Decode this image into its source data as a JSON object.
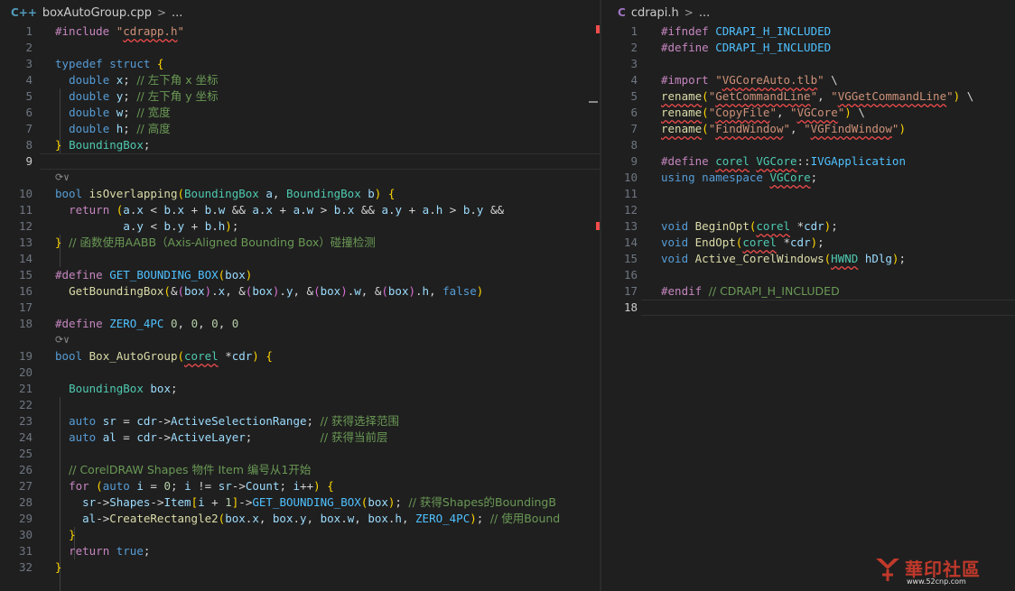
{
  "left_editor": {
    "file_name": "boxAutoGroup.cpp",
    "file_icon": "C++",
    "breadcrumb_sep": ">",
    "breadcrumb_more": "...",
    "lens_icon": "⟳∨",
    "lines": [
      {
        "n": "1",
        "t": "#include \"cdrapp.h\""
      },
      {
        "n": "2",
        "t": ""
      },
      {
        "n": "3",
        "t": "typedef struct {"
      },
      {
        "n": "4",
        "t": "  double x; // 左下角 x 坐标"
      },
      {
        "n": "5",
        "t": "  double y; // 左下角 y 坐标"
      },
      {
        "n": "6",
        "t": "  double w; // 宽度"
      },
      {
        "n": "7",
        "t": "  double h; // 高度"
      },
      {
        "n": "8",
        "t": "} BoundingBox;"
      },
      {
        "n": "9",
        "t": ""
      },
      {
        "n": "10",
        "t": "bool isOverlapping(BoundingBox a, BoundingBox b) {"
      },
      {
        "n": "11",
        "t": "  return (a.x < b.x + b.w && a.x + a.w > b.x && a.y + a.h > b.y &&"
      },
      {
        "n": "12",
        "t": "          a.y < b.y + b.h);"
      },
      {
        "n": "13",
        "t": "} // 函数使用AABB（Axis-Aligned Bounding Box）碰撞检测"
      },
      {
        "n": "14",
        "t": ""
      },
      {
        "n": "15",
        "t": "#define GET_BOUNDING_BOX(box)"
      },
      {
        "n": "16",
        "t": "  GetBoundingBox(&(box).x, &(box).y, &(box).w, &(box).h, false)"
      },
      {
        "n": "17",
        "t": ""
      },
      {
        "n": "18",
        "t": "#define ZERO_4PC 0, 0, 0, 0"
      },
      {
        "n": "19",
        "t": "bool Box_AutoGroup(corel *cdr) {"
      },
      {
        "n": "20",
        "t": ""
      },
      {
        "n": "21",
        "t": "  BoundingBox box;"
      },
      {
        "n": "22",
        "t": ""
      },
      {
        "n": "23",
        "t": "  auto sr = cdr->ActiveSelectionRange; // 获得选择范围"
      },
      {
        "n": "24",
        "t": "  auto al = cdr->ActiveLayer;          // 获得当前层"
      },
      {
        "n": "25",
        "t": ""
      },
      {
        "n": "26",
        "t": "  // CorelDRAW Shapes 物件 Item 编号从1开始"
      },
      {
        "n": "27",
        "t": "  for (auto i = 0; i != sr->Count; i++) {"
      },
      {
        "n": "28",
        "t": "    sr->Shapes->Item[i + 1]->GET_BOUNDING_BOX(box); // 获得Shapes的BoundingB"
      },
      {
        "n": "29",
        "t": "    al->CreateRectangle2(box.x, box.y, box.w, box.h, ZERO_4PC); // 使用Bound"
      },
      {
        "n": "30",
        "t": "  }"
      },
      {
        "n": "31",
        "t": "  return true;"
      },
      {
        "n": "32",
        "t": "}"
      }
    ]
  },
  "right_editor": {
    "file_name": "cdrapi.h",
    "file_icon": "C",
    "breadcrumb_sep": ">",
    "breadcrumb_more": "...",
    "lines": [
      {
        "n": "1",
        "t": "#ifndef CDRAPI_H_INCLUDED"
      },
      {
        "n": "2",
        "t": "#define CDRAPI_H_INCLUDED"
      },
      {
        "n": "3",
        "t": ""
      },
      {
        "n": "4",
        "t": "#import \"VGCoreAuto.tlb\" \\"
      },
      {
        "n": "5",
        "t": "rename(\"GetCommandLine\", \"VGGetCommandLine\") \\"
      },
      {
        "n": "6",
        "t": "rename(\"CopyFile\", \"VGCore\") \\"
      },
      {
        "n": "7",
        "t": "rename(\"FindWindow\", \"VGFindWindow\")"
      },
      {
        "n": "8",
        "t": ""
      },
      {
        "n": "9",
        "t": "#define corel VGCore::IVGApplication"
      },
      {
        "n": "10",
        "t": "using namespace VGCore;"
      },
      {
        "n": "11",
        "t": ""
      },
      {
        "n": "12",
        "t": ""
      },
      {
        "n": "13",
        "t": "void BeginOpt(corel *cdr);"
      },
      {
        "n": "14",
        "t": "void EndOpt(corel *cdr);"
      },
      {
        "n": "15",
        "t": "void Active_CorelWindows(HWND hDlg);"
      },
      {
        "n": "16",
        "t": ""
      },
      {
        "n": "17",
        "t": "#endif // CDRAPI_H_INCLUDED"
      },
      {
        "n": "18",
        "t": ""
      }
    ]
  },
  "watermark": {
    "text": "華印社區",
    "sub": "www.52cnp.com"
  },
  "colors": {
    "background": "#1f1f1f",
    "keyword": "#569cd6",
    "type": "#4ec9b0",
    "function": "#dcdcaa",
    "string": "#ce9178",
    "comment": "#6a9955",
    "preprocessor": "#c586c0",
    "error": "#f14c4c"
  }
}
